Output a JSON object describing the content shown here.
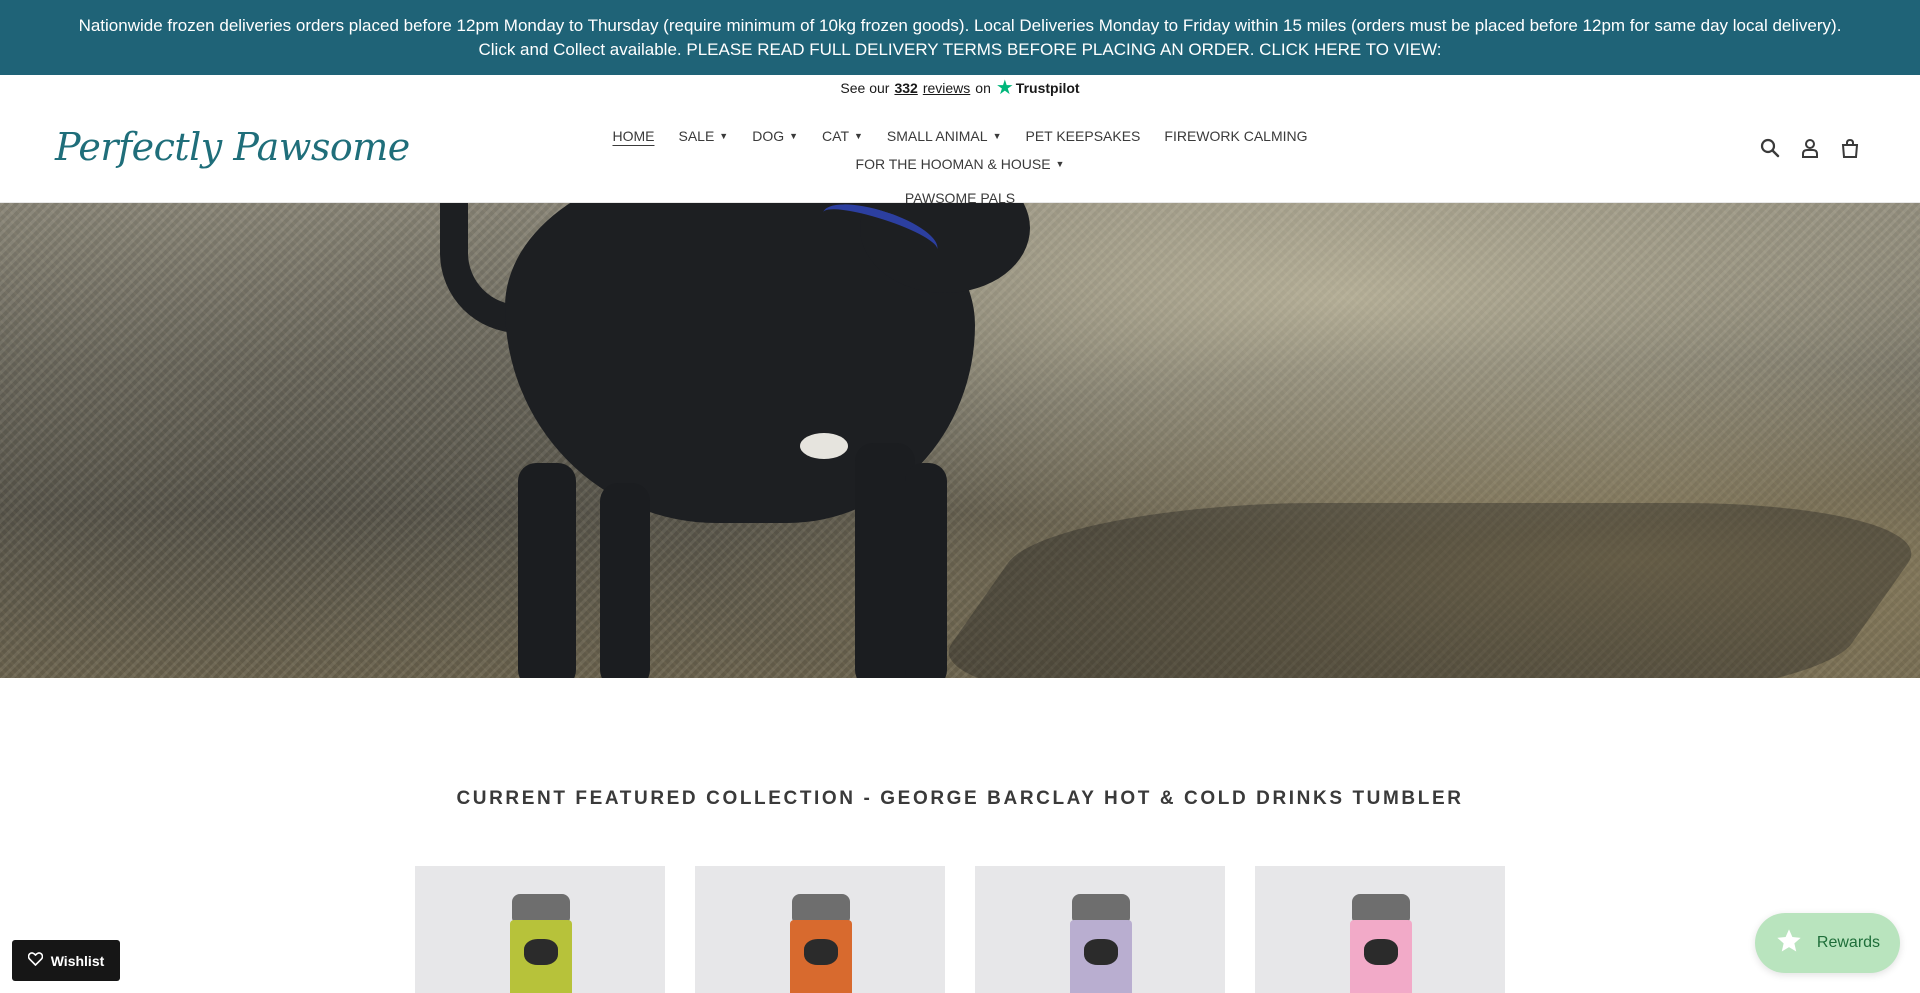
{
  "announcement": {
    "text": "Nationwide frozen deliveries orders placed before 12pm Monday to Thursday (require minimum of 10kg frozen goods). Local Deliveries Monday to Friday within 15 miles (orders must be placed before 12pm for same day local delivery). Click and Collect available. PLEASE READ FULL DELIVERY TERMS BEFORE PLACING AN ORDER. CLICK HERE TO VIEW:"
  },
  "trustpilot": {
    "prefix": "See our",
    "count": "332",
    "reviews": "reviews",
    "suffix": "on",
    "brand": "Trustpilot"
  },
  "logo": {
    "text": "Perfectly Pawsome"
  },
  "nav": {
    "home": "HOME",
    "sale": "SALE",
    "dog": "DOG",
    "cat": "CAT",
    "small_animal": "SMALL ANIMAL",
    "pet_keepsakes": "PET KEEPSAKES",
    "firework_calming": "FIREWORK CALMING",
    "hooman_house": "FOR THE HOOMAN & HOUSE",
    "pawsome_pals": "PAWSOME PALS"
  },
  "header_icons": [
    "search-icon",
    "account-icon",
    "cart-icon"
  ],
  "featured": {
    "title": "CURRENT FEATURED COLLECTION - GEORGE BARCLAY HOT & COLD DRINKS TUMBLER"
  },
  "products": [
    {
      "color": "#b7c23a"
    },
    {
      "color": "#d86a2e"
    },
    {
      "color": "#b9aed0"
    },
    {
      "color": "#f2aac8"
    }
  ],
  "wishlist": {
    "label": "Wishlist"
  },
  "rewards": {
    "label": "Rewards"
  },
  "colors": {
    "announcement_bg": "#1f6377",
    "logo": "#1f6e7a",
    "rewards_bg": "#b9e4be"
  }
}
